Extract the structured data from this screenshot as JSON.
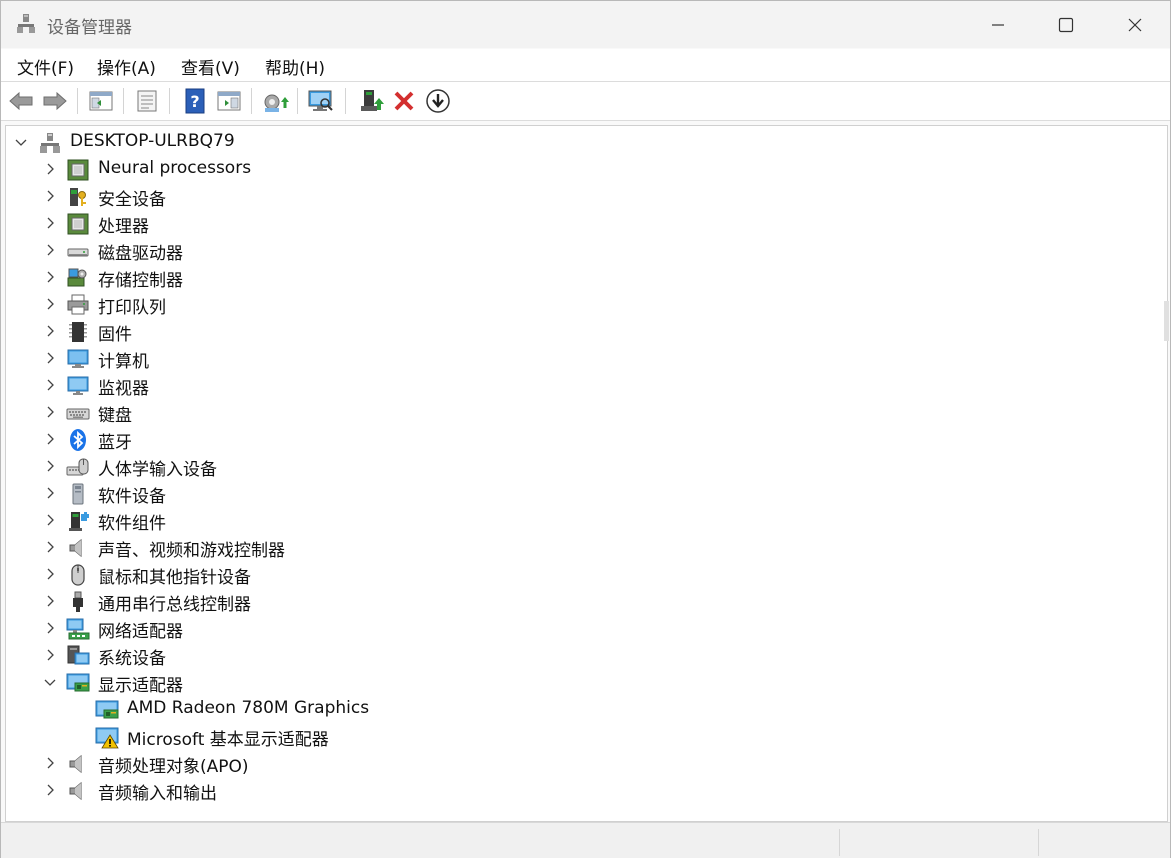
{
  "window": {
    "title": "设备管理器"
  },
  "menu": [
    "文件(F)",
    "操作(A)",
    "查看(V)",
    "帮助(H)"
  ],
  "toolbar": [
    "back-arrow",
    "forward-arrow",
    "show-hide-console-tree",
    "properties",
    "help",
    "action-pane",
    "update-driver",
    "scan-hardware",
    "enable-device",
    "uninstall-device",
    "download-driver"
  ],
  "tree": {
    "root": "DESKTOP-ULRBQ79",
    "categories": [
      {
        "label": "Neural processors",
        "icon": "chip-icon"
      },
      {
        "label": "安全设备",
        "icon": "security-key-icon"
      },
      {
        "label": "处理器",
        "icon": "chip-icon"
      },
      {
        "label": "磁盘驱动器",
        "icon": "disk-drive-icon"
      },
      {
        "label": "存储控制器",
        "icon": "storage-controller-icon"
      },
      {
        "label": "打印队列",
        "icon": "printer-icon"
      },
      {
        "label": "固件",
        "icon": "firmware-icon"
      },
      {
        "label": "计算机",
        "icon": "computer-icon"
      },
      {
        "label": "监视器",
        "icon": "monitor-icon"
      },
      {
        "label": "键盘",
        "icon": "keyboard-icon"
      },
      {
        "label": "蓝牙",
        "icon": "bluetooth-icon"
      },
      {
        "label": "人体学输入设备",
        "icon": "hid-icon"
      },
      {
        "label": "软件设备",
        "icon": "software-device-icon"
      },
      {
        "label": "软件组件",
        "icon": "software-component-icon"
      },
      {
        "label": "声音、视频和游戏控制器",
        "icon": "speaker-icon"
      },
      {
        "label": "鼠标和其他指针设备",
        "icon": "mouse-icon"
      },
      {
        "label": "通用串行总线控制器",
        "icon": "usb-icon"
      },
      {
        "label": "网络适配器",
        "icon": "network-adapter-icon"
      },
      {
        "label": "系统设备",
        "icon": "system-device-icon"
      },
      {
        "label": "显示适配器",
        "icon": "display-adapter-icon",
        "expanded": true,
        "children": [
          {
            "label": "AMD Radeon 780M Graphics",
            "icon": "display-adapter-icon"
          },
          {
            "label": "Microsoft 基本显示适配器",
            "icon": "display-adapter-warning-icon"
          }
        ]
      },
      {
        "label": "音频处理对象(APO)",
        "icon": "speaker-icon"
      },
      {
        "label": "音频输入和输出",
        "icon": "speaker-icon"
      }
    ]
  },
  "colors": {
    "error_red": "#d32f2f",
    "help_blue": "#2b5fb8",
    "monitor_blue": "#3a9be0",
    "chip_green": "#5a8a3c"
  }
}
